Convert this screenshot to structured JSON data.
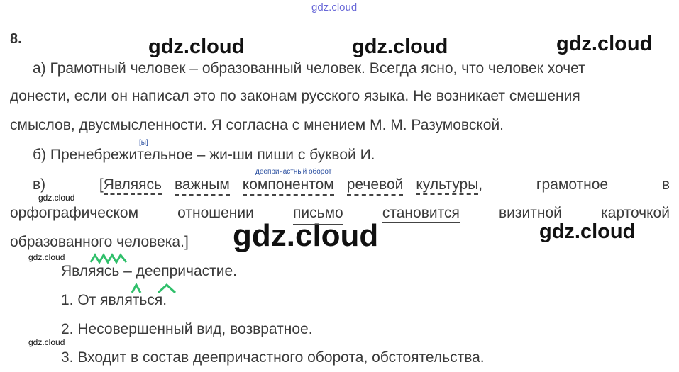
{
  "watermarks": {
    "top": "gdz.cloud",
    "big": "gdz.cloud",
    "small": "gdz.cloud"
  },
  "task_number": "8.",
  "para_a": {
    "line1": "а) Грамотный человек – образованный человек. Всегда ясно, что человек хочет",
    "line2": "донести, если он написал это по законам русского языка. Не возникает смешения",
    "line3": "смыслов, двусмысленности. Я согласна с мнением М. М. Разумовской."
  },
  "para_b": {
    "note": "[ы]",
    "text": "б) Пренебрежительное – жи-ши пиши с буквой И."
  },
  "para_c": {
    "note": "деепричастный оборот",
    "line1": {
      "label": "в)",
      "bracket": "[",
      "w1": "Являясь",
      "w2": "важным",
      "w3": "компонентом",
      "w4": "речевой",
      "w5": "культуры",
      "comma": ",",
      "w6": "грамотное",
      "w7": "в"
    },
    "line2": {
      "w1": "орфографическом",
      "w2": "отношении",
      "w3": "письмо",
      "w4": "становится",
      "w5": "визитной",
      "w6": "карточкой"
    },
    "line3": "образованного человека.]"
  },
  "analysis": {
    "word": "Являясь",
    "rest": " – деепричастие.",
    "item1_prefix": "1. От ",
    "item1_word": "являться",
    "item1_end": ".",
    "item2": "2. Несовершенный вид, возвратное.",
    "item3": "3. Входит в состав деепричастного оборота, обстоятельства."
  },
  "colors": {
    "mark_green": "#2fbf6a",
    "watermark_blue": "#6a6ad8",
    "note_blue": "#2a4fa0"
  }
}
